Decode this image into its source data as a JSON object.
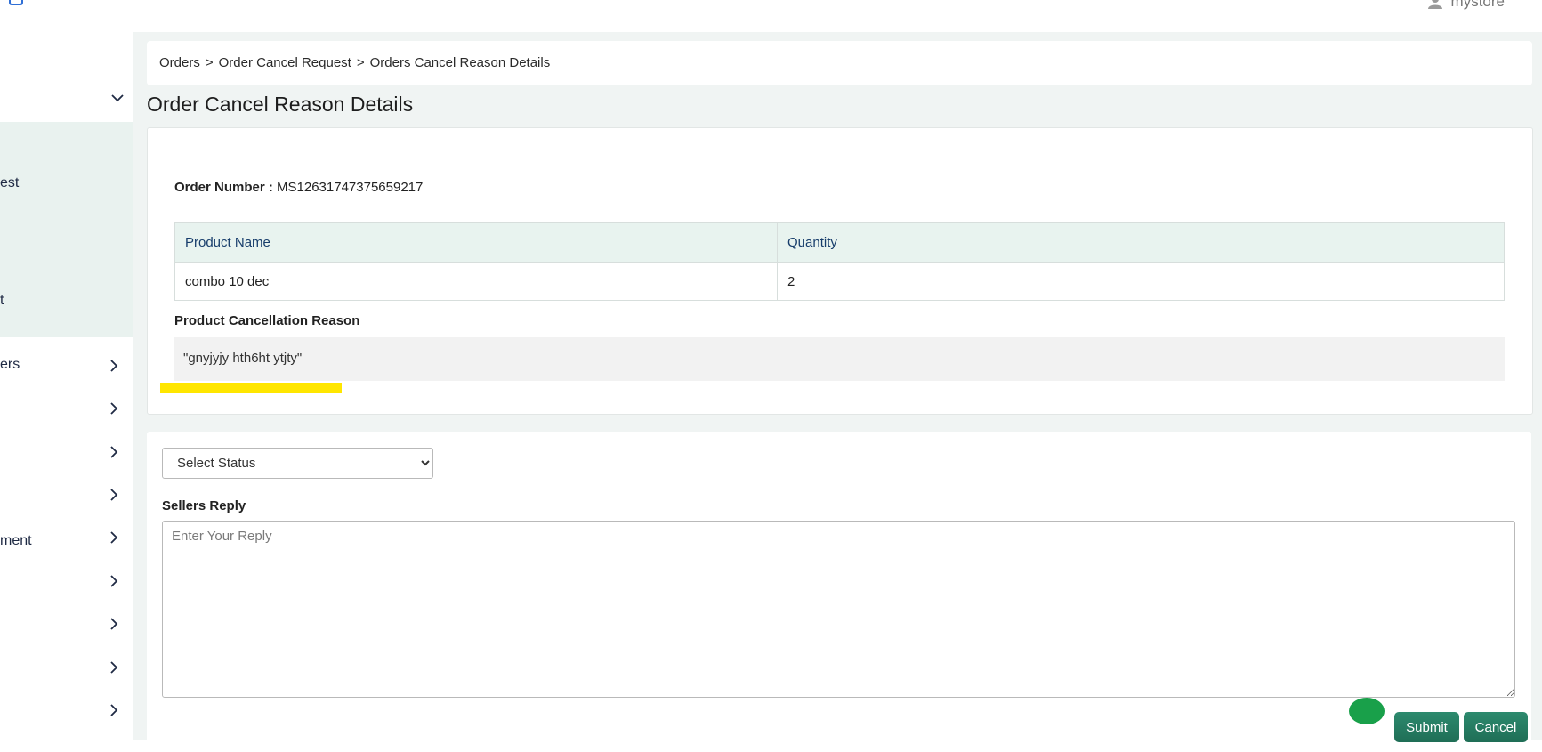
{
  "header": {
    "user_name": "mystore"
  },
  "sidebar": {
    "top_item_label": "",
    "submenu": [
      {
        "label": "est"
      },
      {
        "label": "t"
      }
    ],
    "items": [
      {
        "label": "ers"
      },
      {
        "label": ""
      },
      {
        "label": ""
      },
      {
        "label": ""
      },
      {
        "label": "ment"
      },
      {
        "label": ""
      },
      {
        "label": ""
      },
      {
        "label": ""
      },
      {
        "label": ""
      }
    ]
  },
  "breadcrumb": [
    "Orders",
    "Order Cancel Request",
    "Orders Cancel Reason Details"
  ],
  "breadcrumb_separator": ">",
  "page_title": "Order Cancel Reason Details",
  "order": {
    "number_label": "Order Number :",
    "number_value": "MS1263174737565921​7"
  },
  "product_table": {
    "columns": [
      "Product Name",
      "Quantity"
    ],
    "rows": [
      [
        "combo 10 dec",
        "2"
      ]
    ]
  },
  "cancellation": {
    "label": "Product Cancellation Reason",
    "reason": "\"gnyjyjy hth6ht ytjty\""
  },
  "reply_form": {
    "status_selected": "Select Status",
    "reply_label": "Sellers Reply",
    "reply_placeholder": "Enter Your Reply",
    "reply_value": "",
    "submit_label": "Submit",
    "cancel_label": "Cancel"
  },
  "colors": {
    "accent": "#1f6e56",
    "table_header_bg": "#e8f3ef",
    "highlight": "#ffe600",
    "sidebar_active_bg": "#e9f2ef"
  }
}
